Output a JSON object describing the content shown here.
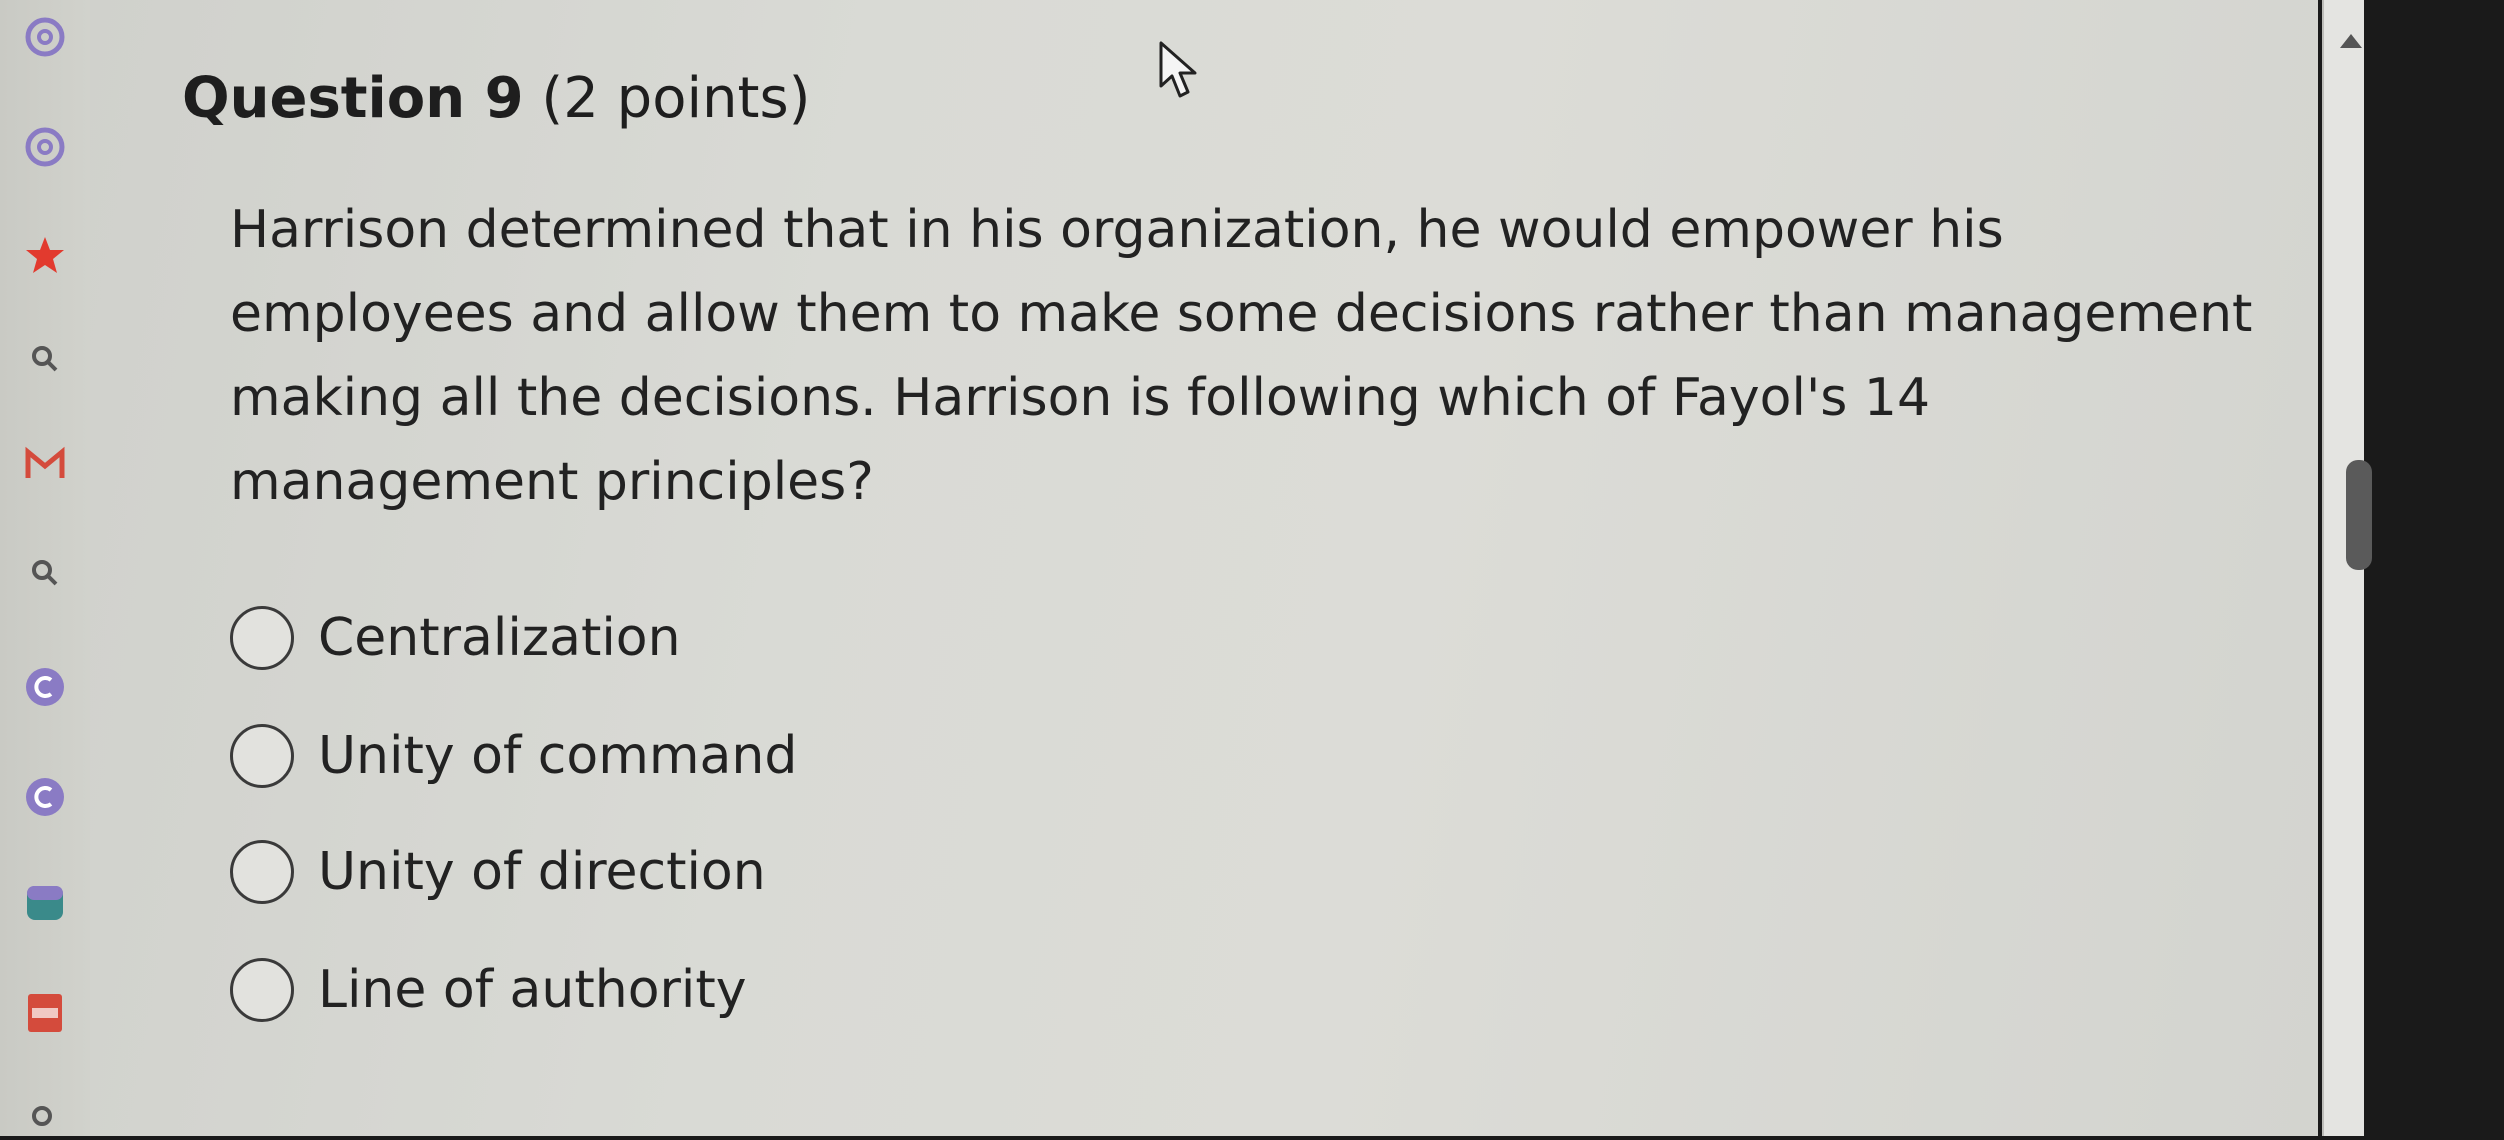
{
  "question": {
    "number_label": "Question 9",
    "points_label": "(2 points)",
    "text": "Harrison determined that in his organization, he would empower his employees and allow them to make some decisions rather than management making all the decisions. Harrison is following which of Fayol's 14 management principles?"
  },
  "options": [
    {
      "label": "Centralization"
    },
    {
      "label": "Unity of command"
    },
    {
      "label": "Unity of direction"
    },
    {
      "label": "Line of authority"
    }
  ],
  "sidebar": {
    "icons": [
      "at-icon",
      "at-icon",
      "star-icon",
      "search-icon",
      "gmail-icon",
      "search-icon",
      "c-circle-icon",
      "c-circle-icon",
      "database-icon",
      "pdf-icon",
      "search-icon"
    ],
    "accent_colors": {
      "purple": "#8a7bc4",
      "star": "#e23a2e",
      "gmail_red": "#d44b3c",
      "teal": "#3a8a8a"
    }
  },
  "colors": {
    "page_bg": "#d9dad5",
    "text": "#222222",
    "scroll_thumb": "#5a5a5a"
  }
}
